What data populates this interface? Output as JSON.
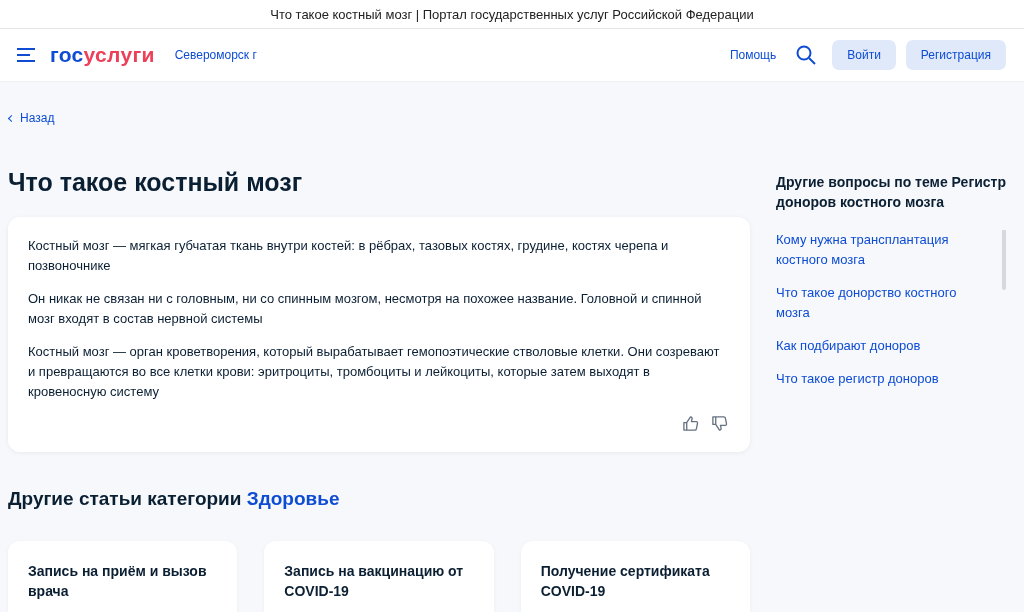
{
  "window": {
    "title": "Что такое костный мозг | Портал государственных услуг Российской Федерации"
  },
  "header": {
    "logo": {
      "part_1": "гос",
      "part_2": "услуги"
    },
    "location": "Североморск г",
    "help": "Помощь",
    "buttons": [
      "Войти",
      "Регистрация"
    ]
  },
  "back_link": "Назад",
  "article": {
    "title": "Что такое костный мозг",
    "paragraphs": [
      "Костный мозг — мягкая губчатая ткань внутри костей: в рёбрах, тазовых костях, грудине, костях черепа и позвоночнике",
      "Он никак не связан ни с головным, ни со спинным мозгом, несмотря на похожее название. Головной и спинной мозг входят в состав нервной системы",
      "Костный мозг — орган кроветворения, который вырабатывает гемопоэтические стволовые клетки. Они созревают и превращаются во все клетки крови: эритроциты, тромбоциты и лейкоциты, которые затем выходят в кровеносную систему"
    ]
  },
  "sidebar": {
    "title": "Другие вопросы по теме Регистр доноров костного мозга",
    "items": [
      "Кому нужна трансплантация костного мозга",
      "Что такое донорство костного мозга",
      "Как подбирают доноров",
      "Что такое регистр доноров"
    ]
  },
  "related": {
    "title": "Другие статьи категории",
    "category": "Здоровье",
    "cards": [
      "Запись на приём и вызов врача",
      "Запись на вакцинацию от COVID-19",
      "Получение сертификата COVID-19"
    ]
  }
}
